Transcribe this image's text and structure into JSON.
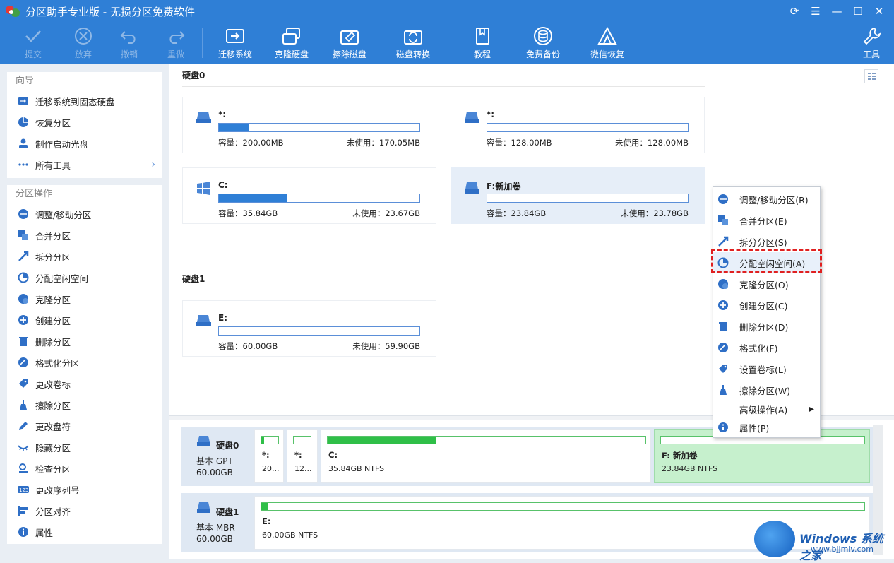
{
  "window": {
    "title": "分区助手专业版 - 无损分区免费软件"
  },
  "toolbar": {
    "commit": "提交",
    "discard": "放弃",
    "undo": "撤销",
    "redo": "重做",
    "migrate_os": "迁移系统",
    "clone_disk": "克隆硬盘",
    "wipe_disk": "擦除磁盘",
    "convert_disk": "磁盘转换",
    "tutorial": "教程",
    "free_backup": "免费备份",
    "wechat_recovery": "微信恢复",
    "tools": "工具"
  },
  "sidebar": {
    "wizard_title": "向导",
    "wizard_items": [
      "迁移系统到固态硬盘",
      "恢复分区",
      "制作启动光盘",
      "所有工具"
    ],
    "ops_title": "分区操作",
    "ops_items": [
      "调整/移动分区",
      "合并分区",
      "拆分分区",
      "分配空闲空间",
      "克隆分区",
      "创建分区",
      "删除分区",
      "格式化分区",
      "更改卷标",
      "擦除分区",
      "更改盘符",
      "隐藏分区",
      "检查分区",
      "更改序列号",
      "分区对齐",
      "属性"
    ]
  },
  "main": {
    "disk0_label": "硬盘0",
    "disk1_label": "硬盘1",
    "partitions": [
      {
        "name": "*:",
        "capacity": "容量：200.00MB",
        "free": "未使用：170.05MB",
        "used_fraction": 0.15
      },
      {
        "name": "*:",
        "capacity": "容量：128.00MB",
        "free": "未使用：128.00MB",
        "used_fraction": 0.0
      },
      {
        "name": "C:",
        "capacity": "容量：35.84GB",
        "free": "未使用：23.67GB",
        "used_fraction": 0.34
      },
      {
        "name": "F:新加卷",
        "capacity": "容量：23.84GB",
        "free": "未使用：23.78GB",
        "used_fraction": 0.0
      },
      {
        "name": "E:",
        "capacity": "容量：60.00GB",
        "free": "未使用：59.90GB",
        "used_fraction": 0.0
      }
    ]
  },
  "diskmap": {
    "disk0": {
      "name": "硬盘0",
      "type": "基本 GPT",
      "size": "60.00GB",
      "parts": [
        {
          "name": "*:",
          "info": "20...",
          "used_fraction": 0.15
        },
        {
          "name": "*:",
          "info": "12...",
          "used_fraction": 0.0
        },
        {
          "name": "C:",
          "info": "35.84GB NTFS",
          "used_fraction": 0.34
        },
        {
          "name": "F: 新加卷",
          "info": "23.84GB NTFS",
          "used_fraction": 0.0
        }
      ]
    },
    "disk1": {
      "name": "硬盘1",
      "type": "基本 MBR",
      "size": "60.00GB",
      "parts": [
        {
          "name": "E:",
          "info": "60.00GB NTFS",
          "used_fraction": 0.01
        }
      ]
    }
  },
  "context_menu": {
    "items": [
      "调整/移动分区(R)",
      "合并分区(E)",
      "拆分分区(S)",
      "分配空闲空间(A)",
      "克隆分区(O)",
      "创建分区(C)",
      "删除分区(D)",
      "格式化(F)",
      "设置卷标(L)",
      "擦除分区(W)",
      "高级操作(A)",
      "属性(P)"
    ]
  },
  "watermark": {
    "brand": "Windows 系统之家",
    "url": "www.bjjmlv.com"
  },
  "colors": {
    "accent": "#2f7fd6",
    "used_bar": "#2fbf48",
    "highlight": "#e02020"
  }
}
